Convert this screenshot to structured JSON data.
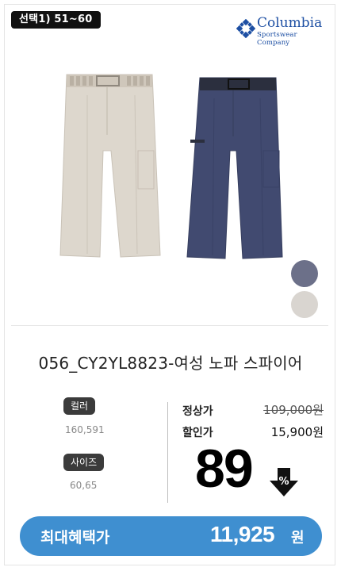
{
  "badge": "선택1) 51~60",
  "brand": {
    "name": "Columbia",
    "sub": "Sportswear Company"
  },
  "product": {
    "title": "056_CY2YL8823-여성 노파 스파이어"
  },
  "swatches": [
    "#6c7089",
    "#d9d5d0"
  ],
  "options": {
    "color_label": "컬러",
    "color_value": "160,591",
    "size_label": "사이즈",
    "size_value": "60,65"
  },
  "price": {
    "regular_label": "정상가",
    "regular": "109,000원",
    "sale_label": "할인가",
    "sale": "15,900원",
    "discount_rate": "89",
    "discount_symbol": "%"
  },
  "cta": {
    "label": "최대혜택가",
    "amount": "11,925",
    "unit": "원"
  }
}
